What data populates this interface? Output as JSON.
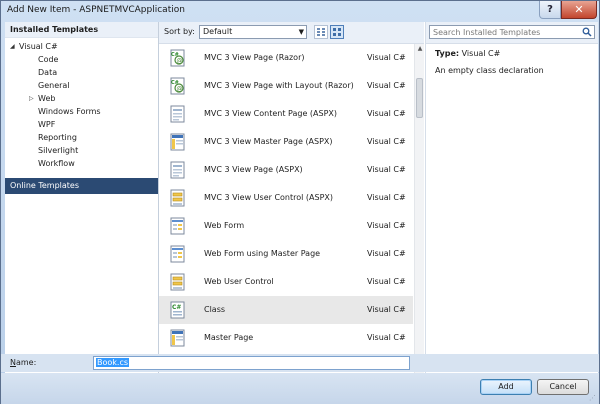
{
  "window": {
    "title": "Add New Item - ASPNETMVCApplication",
    "help_glyph": "?",
    "close_glyph": "✕"
  },
  "left": {
    "installed_header": "Installed Templates",
    "tree": [
      {
        "label": "Visual C#",
        "level": 0,
        "expanded": true
      },
      {
        "label": "Code",
        "level": 1
      },
      {
        "label": "Data",
        "level": 1
      },
      {
        "label": "General",
        "level": 1
      },
      {
        "label": "Web",
        "level": 1,
        "collapsed": true
      },
      {
        "label": "Windows Forms",
        "level": 1
      },
      {
        "label": "WPF",
        "level": 1
      },
      {
        "label": "Reporting",
        "level": 1
      },
      {
        "label": "Silverlight",
        "level": 1
      },
      {
        "label": "Workflow",
        "level": 1
      }
    ],
    "online_header": "Online Templates",
    "expanded_glyph": "◢",
    "collapsed_glyph": "▷"
  },
  "toolbar": {
    "sort_label": "Sort by:",
    "sort_value": "Default"
  },
  "templates": [
    {
      "name": "MVC 3 View Page (Razor)",
      "lang": "Visual C#",
      "icon": "razor-view-icon"
    },
    {
      "name": "MVC 3 View Page with Layout (Razor)",
      "lang": "Visual C#",
      "icon": "razor-view-icon"
    },
    {
      "name": "MVC 3 View Content Page (ASPX)",
      "lang": "Visual C#",
      "icon": "aspx-page-icon"
    },
    {
      "name": "MVC 3 View Master Page (ASPX)",
      "lang": "Visual C#",
      "icon": "master-page-icon"
    },
    {
      "name": "MVC 3 View Page (ASPX)",
      "lang": "Visual C#",
      "icon": "aspx-page-icon"
    },
    {
      "name": "MVC 3 View User Control (ASPX)",
      "lang": "Visual C#",
      "icon": "user-control-icon"
    },
    {
      "name": "Web Form",
      "lang": "Visual C#",
      "icon": "web-form-icon"
    },
    {
      "name": "Web Form using Master Page",
      "lang": "Visual C#",
      "icon": "web-form-icon"
    },
    {
      "name": "Web User Control",
      "lang": "Visual C#",
      "icon": "user-control-icon"
    },
    {
      "name": "Class",
      "lang": "Visual C#",
      "icon": "class-icon",
      "selected": true
    },
    {
      "name": "Master Page",
      "lang": "Visual C#",
      "icon": "master-page-icon"
    }
  ],
  "right": {
    "search_placeholder": "Search Installed Templates",
    "type_label": "Type:",
    "type_value": "Visual C#",
    "description": "An empty class declaration"
  },
  "bottom": {
    "name_label": "Name:",
    "name_value": "Book.cs",
    "add_label": "Add",
    "cancel_label": "Cancel"
  },
  "colors": {
    "online_header_bg": "#2b4a73",
    "selected_row_bg": "#e8e8e8",
    "close_button": "#c2452d",
    "chrome_blue": "#c6d6ea"
  }
}
